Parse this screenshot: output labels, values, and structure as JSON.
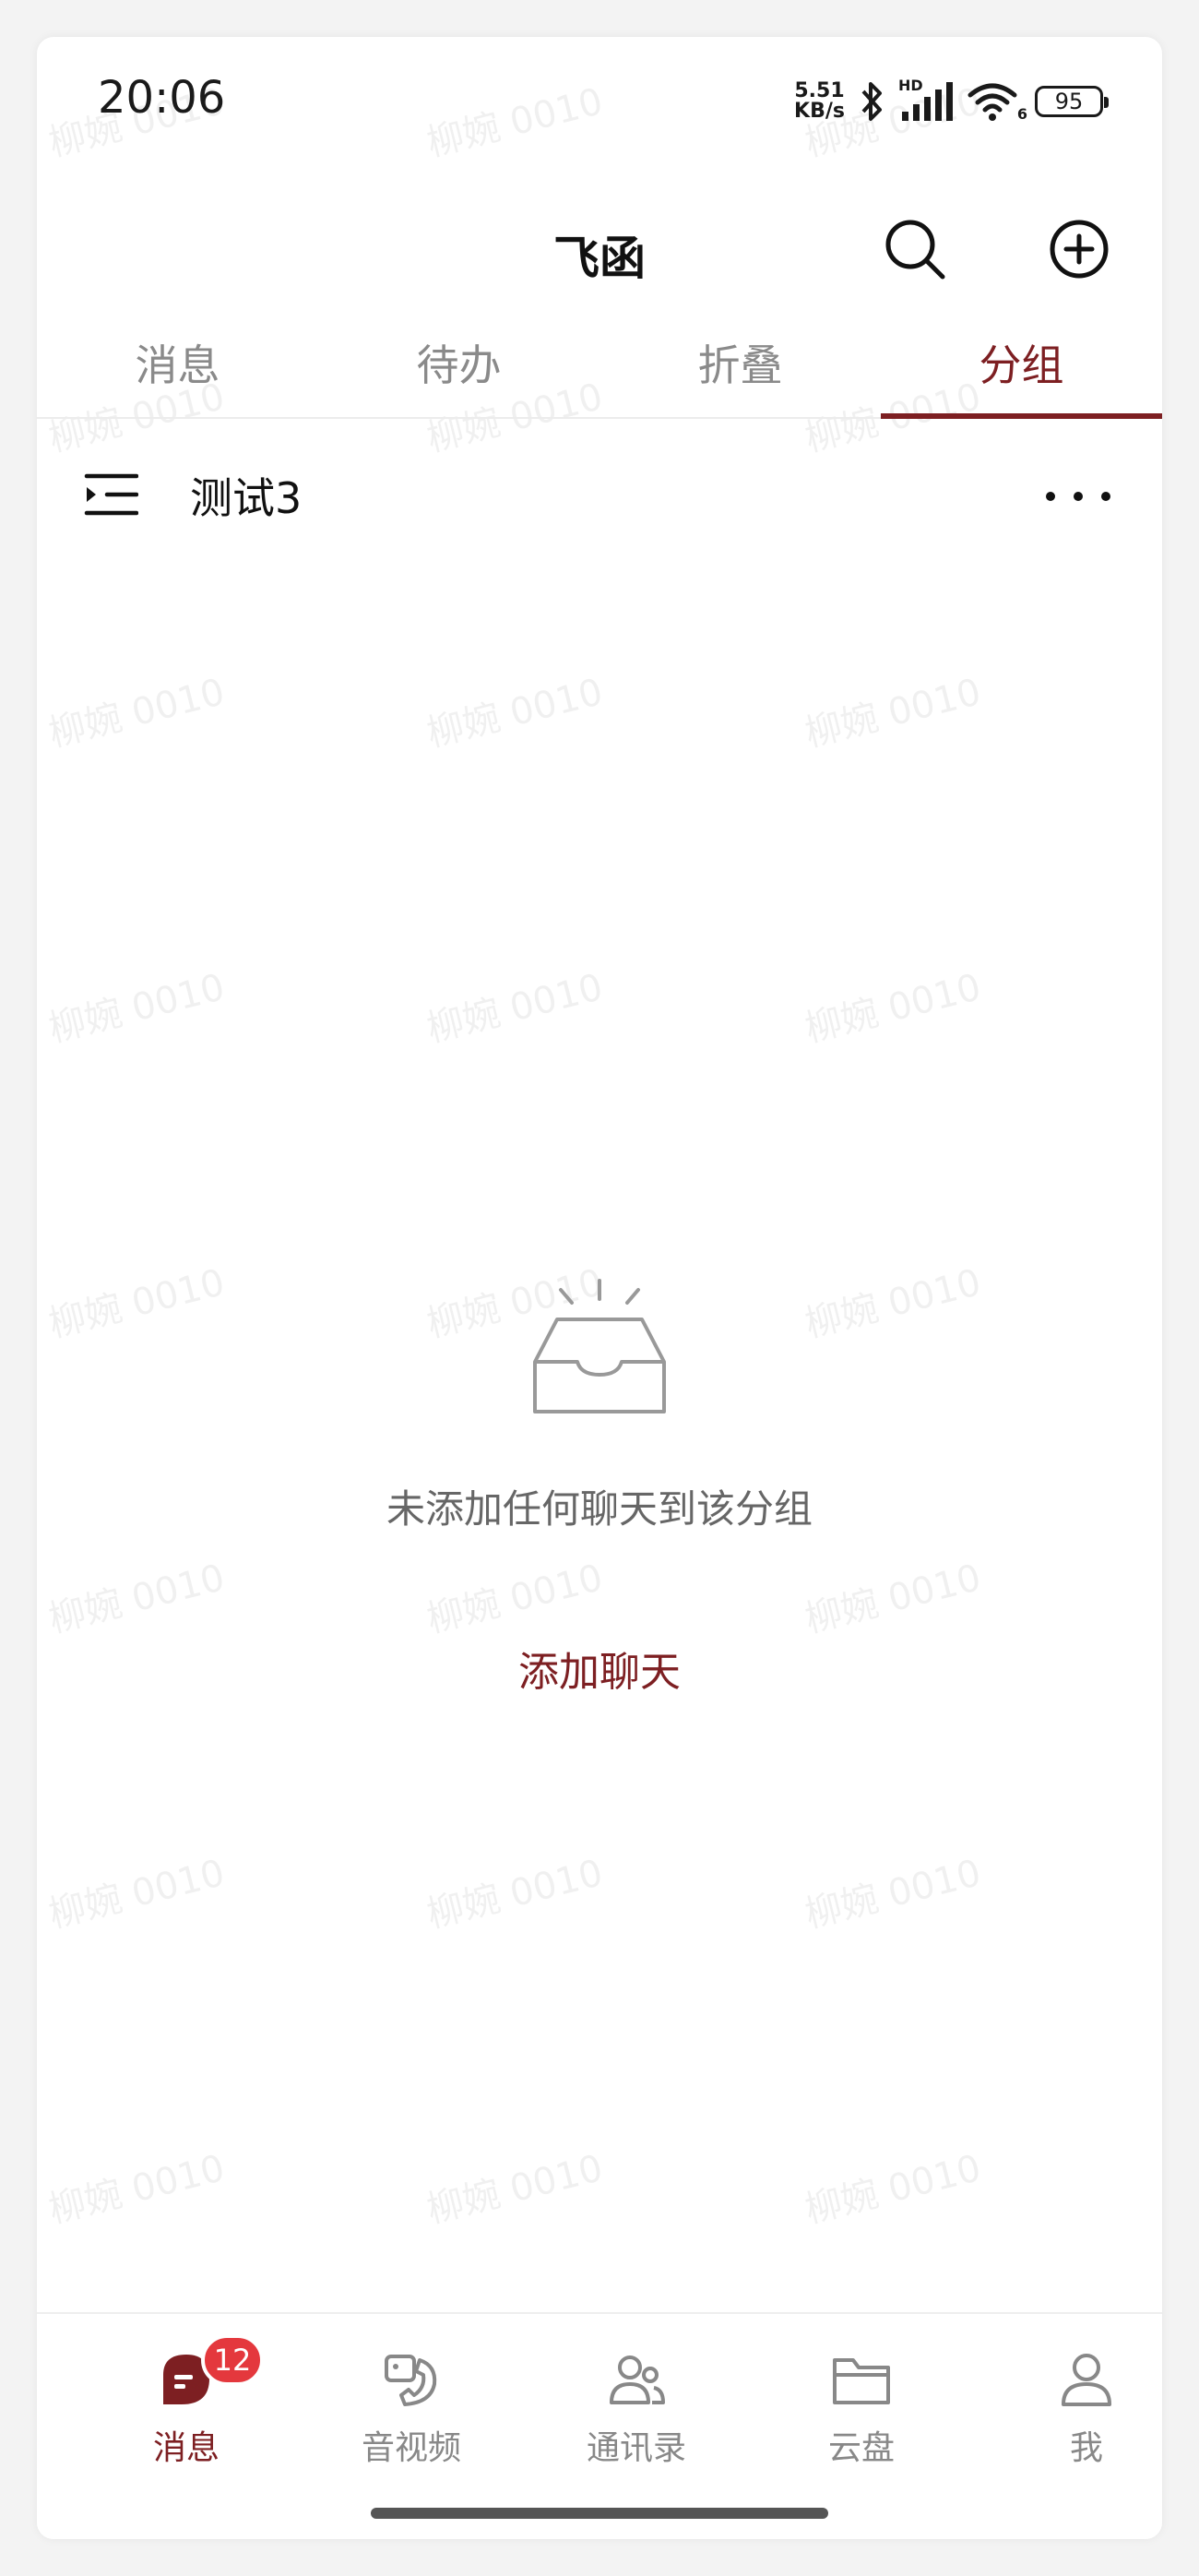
{
  "status_bar": {
    "time": "20:06",
    "net_speed_value": "5.51",
    "net_speed_unit": "KB/s",
    "signal_label": "HD",
    "wifi_label": "6",
    "battery": "95"
  },
  "header": {
    "title": "飞函",
    "search_icon": "search-icon",
    "add_icon": "plus-circle-icon"
  },
  "tabs": [
    {
      "label": "消息",
      "active": false
    },
    {
      "label": "待办",
      "active": false
    },
    {
      "label": "折叠",
      "active": false
    },
    {
      "label": "分组",
      "active": true
    }
  ],
  "group": {
    "title": "测试3"
  },
  "empty_state": {
    "icon": "empty-inbox-icon",
    "message": "未添加任何聊天到该分组",
    "action": "添加聊天"
  },
  "bottom_nav": [
    {
      "label": "消息",
      "icon": "message-icon",
      "badge": "12",
      "active": true
    },
    {
      "label": "音视频",
      "icon": "video-call-icon",
      "active": false
    },
    {
      "label": "通讯录",
      "icon": "contacts-icon",
      "active": false
    },
    {
      "label": "云盘",
      "icon": "folder-icon",
      "active": false
    },
    {
      "label": "我",
      "icon": "profile-icon",
      "active": false
    }
  ],
  "watermark": "柳婉 0010",
  "colors": {
    "accent": "#7d1f22",
    "badge": "#e4383d",
    "muted_text": "#888888"
  }
}
